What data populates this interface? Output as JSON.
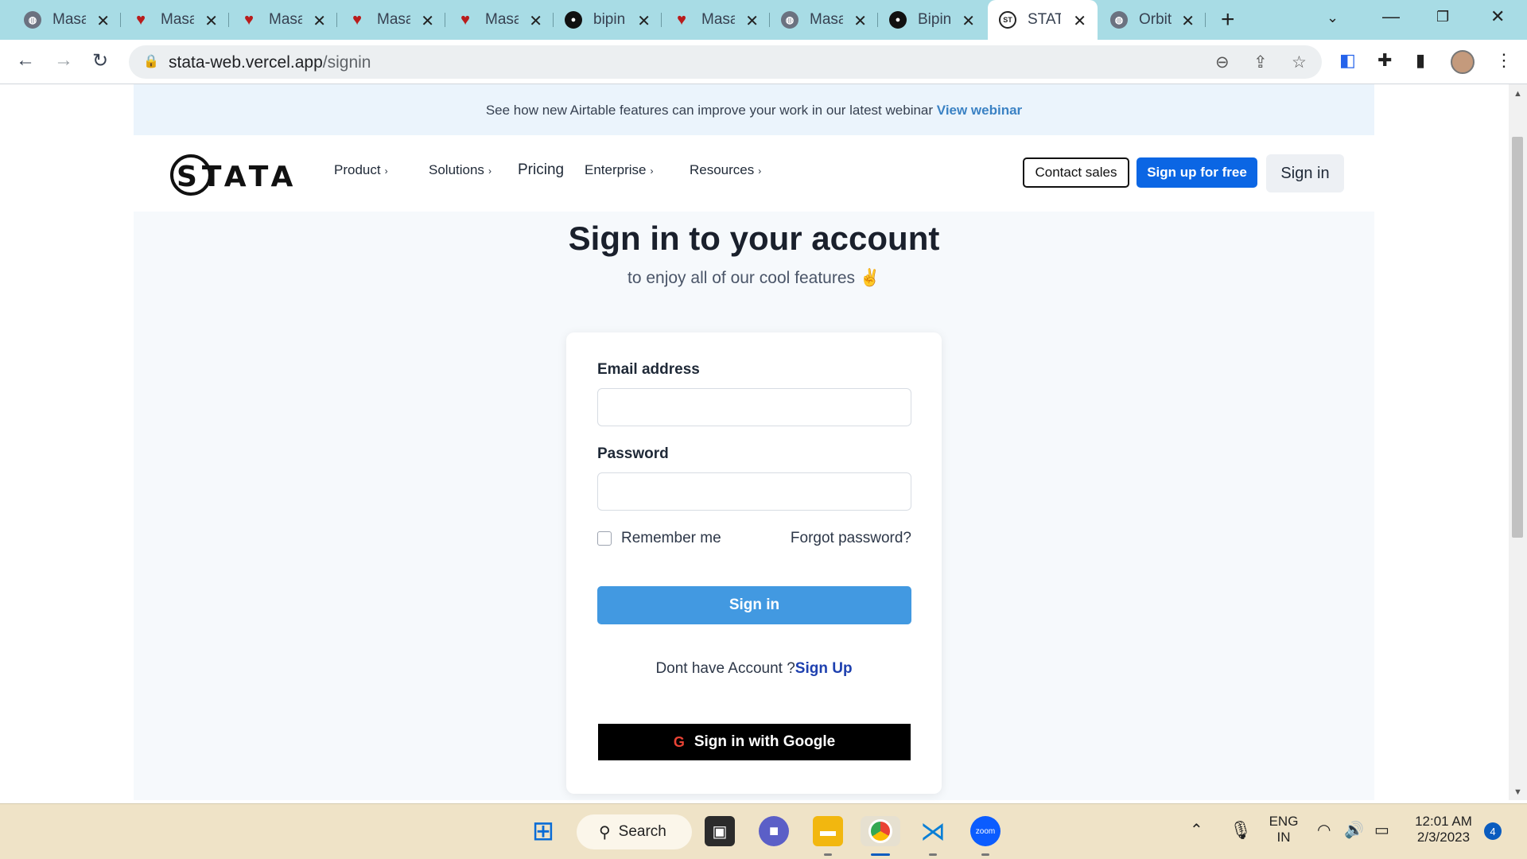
{
  "browser": {
    "tabs": [
      {
        "title": "Masa",
        "icon": "globe-icon"
      },
      {
        "title": "Masa",
        "icon": "pin-icon"
      },
      {
        "title": "Masa",
        "icon": "pin-icon"
      },
      {
        "title": "Masa",
        "icon": "pin-icon"
      },
      {
        "title": "Masa",
        "icon": "pin-icon"
      },
      {
        "title": "bipin",
        "icon": "github-icon"
      },
      {
        "title": "Masa",
        "icon": "pin-icon"
      },
      {
        "title": "Masa",
        "icon": "globe-icon"
      },
      {
        "title": "Bipin",
        "icon": "github-icon"
      },
      {
        "title": "STATA",
        "icon": "stata-icon",
        "active": true
      },
      {
        "title": "Orbit",
        "icon": "globe-icon"
      }
    ],
    "url_host": "stata-web.vercel.app",
    "url_path": "/signin"
  },
  "banner": {
    "text": "See how new Airtable features can improve your work in our latest webinar",
    "link": "View webinar"
  },
  "nav": {
    "logo": "STATA",
    "items": [
      "Product",
      "Solutions",
      "Pricing",
      "Enterprise",
      "Resources"
    ],
    "contact_sales": "Contact sales",
    "sign_up": "Sign up for free",
    "sign_in": "Sign in"
  },
  "signin": {
    "heading": "Sign in to your account",
    "subheading": "to enjoy all of our cool features ✌️",
    "email_label": "Email address",
    "email_value": "",
    "password_label": "Password",
    "password_value": "",
    "remember_me": "Remember me",
    "forgot_password": "Forgot password?",
    "submit": "Sign in",
    "no_account": "Dont have Account ?",
    "sign_up_link": "Sign Up",
    "google": "Sign in with Google"
  },
  "taskbar": {
    "search": "Search",
    "lang_top": "ENG",
    "lang_bottom": "IN",
    "time": "12:01 AM",
    "date": "2/3/2023",
    "notifications": "4"
  },
  "colors": {
    "primary_blue": "#0b66e4",
    "signin_button": "#4299e1",
    "tabstrip": "#a8dce5",
    "taskbar": "#efe3c7"
  }
}
